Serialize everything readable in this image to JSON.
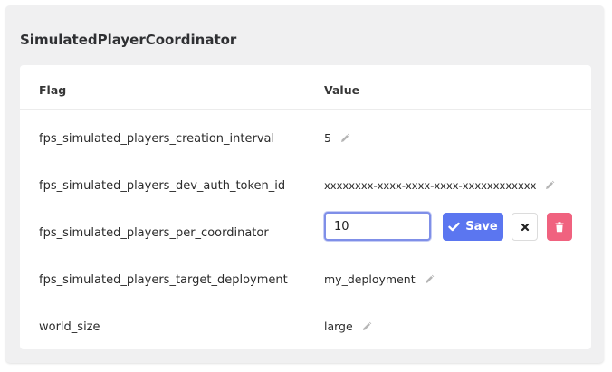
{
  "panel": {
    "title": "SimulatedPlayerCoordinator"
  },
  "table": {
    "headers": {
      "flag": "Flag",
      "value": "Value"
    },
    "rows": [
      {
        "flag": "fps_simulated_players_creation_interval",
        "value": "5"
      },
      {
        "flag": "fps_simulated_players_dev_auth_token_id",
        "value": "xxxxxxxx-xxxx-xxxx-xxxx-xxxxxxxxxxxx"
      },
      {
        "flag": "fps_simulated_players_per_coordinator",
        "value": "10"
      },
      {
        "flag": "fps_simulated_players_target_deployment",
        "value": "my_deployment"
      },
      {
        "flag": "world_size",
        "value": "large"
      }
    ]
  },
  "edit": {
    "save_label": "Save",
    "icons": {
      "save": "check-icon",
      "cancel": "close-icon",
      "delete": "trash-icon",
      "edit": "pencil-icon"
    }
  },
  "colors": {
    "save_button": "#5b76f0",
    "delete_button": "#f0627f",
    "panel_background": "#f0f0f1",
    "input_focus_border": "#7f8fe8"
  }
}
